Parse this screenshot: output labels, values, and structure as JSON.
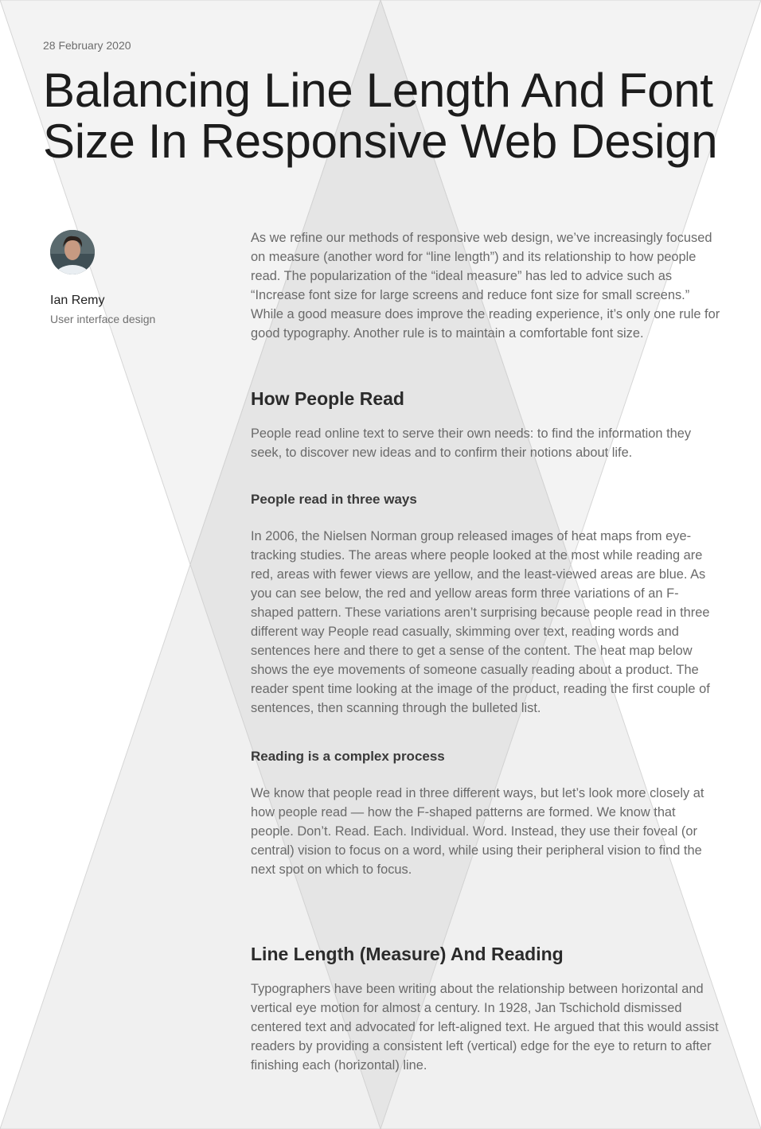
{
  "article": {
    "date": "28 February 2020",
    "title": "Balancing Line Length And Font Size In Responsive Web Design"
  },
  "author": {
    "name": "Ian Remy",
    "role": "User interface design"
  },
  "body": {
    "intro": "As we refine our methods of responsive web design, we’ve increasingly focused on measure (another word for “line length”) and its relationship to how people read. The popularization of the “ideal measure” has led to advice such as “Increase font size for large screens and reduce font size for small screens.” While a good measure does improve the reading experience, it’s only one rule for good typography. Another rule is to maintain a comfortable font size.",
    "how_people_read": {
      "heading": "How People Read",
      "text": "People read online text to serve their own needs: to find the information they seek, to discover new ideas and to confirm their notions about life."
    },
    "three_ways": {
      "heading": "People read in three ways",
      "text": "In 2006, the Nielsen Norman group released images of heat maps from eye-tracking studies. The areas where people looked at the most while reading are red, areas with fewer views are yellow, and the least-viewed areas are blue. As you can see below, the red and yellow areas form three variations of an F-shaped pattern. These variations aren’t surprising because people read in three different way People read casually, skimming over text, reading words and sentences here and there to get a sense of the content. The heat map below shows the eye movements of someone casually reading about a product. The reader spent time looking at the image of the product, reading the first couple of sentences, then scanning through the bulleted list."
    },
    "complex_process": {
      "heading": "Reading is a complex process",
      "text": "We know that people read in three different ways, but let’s look more closely at how people read — how the F-shaped patterns are formed. We know that people. Don’t. Read. Each. Individual. Word. Instead, they use their foveal (or central) vision to focus on a word, while using their peripheral vision to find the next spot on which to focus."
    },
    "line_length": {
      "heading": "Line Length (Measure) And Reading",
      "text": "Typographers have been writing about the relationship between horizontal and vertical eye motion for almost a century. In 1928, Jan Tschichold dismissed centered text and advocated for left-aligned text. He argued that this would assist readers by providing a consistent left (vertical) edge for the eye to return to after finishing each (horizontal) line."
    }
  },
  "colors": {
    "background": "#ffffff",
    "shape_light": "#f3f3f3",
    "shape_mid": "#e6e6e6",
    "title_text": "#1c1c1c",
    "body_text": "#6a6a6a"
  }
}
